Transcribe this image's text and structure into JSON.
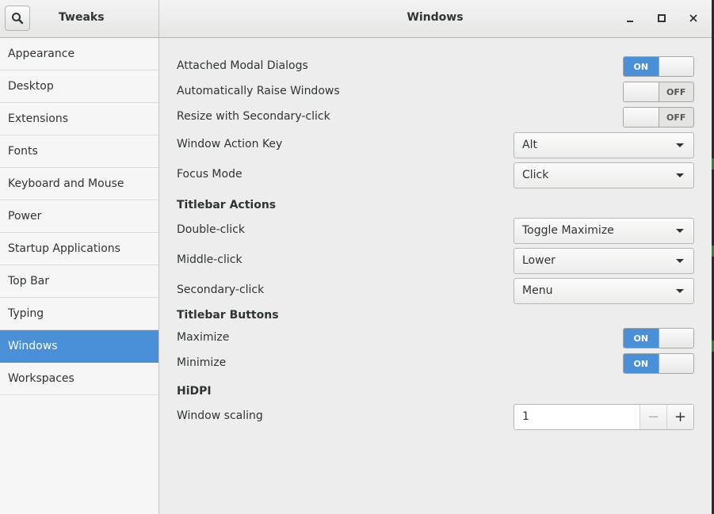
{
  "header": {
    "app_title": "Tweaks",
    "window_title": "Windows",
    "search_icon": "search-icon",
    "controls": [
      "minimize-icon",
      "maximize-icon",
      "close-icon"
    ]
  },
  "sidebar": {
    "items": [
      {
        "label": "Appearance"
      },
      {
        "label": "Desktop"
      },
      {
        "label": "Extensions"
      },
      {
        "label": "Fonts"
      },
      {
        "label": "Keyboard and Mouse"
      },
      {
        "label": "Power"
      },
      {
        "label": "Startup Applications"
      },
      {
        "label": "Top Bar"
      },
      {
        "label": "Typing"
      },
      {
        "label": "Windows",
        "selected": true
      },
      {
        "label": "Workspaces"
      }
    ]
  },
  "settings": {
    "attached_modal": {
      "label": "Attached Modal Dialogs",
      "state": "ON"
    },
    "auto_raise": {
      "label": "Automatically Raise Windows",
      "state": "OFF"
    },
    "resize_secondary": {
      "label": "Resize with Secondary-click",
      "state": "OFF"
    },
    "action_key": {
      "label": "Window Action Key",
      "value": "Alt"
    },
    "focus_mode": {
      "label": "Focus Mode",
      "value": "Click"
    }
  },
  "titlebar_actions": {
    "heading": "Titlebar Actions",
    "double_click": {
      "label": "Double-click",
      "value": "Toggle Maximize"
    },
    "middle_click": {
      "label": "Middle-click",
      "value": "Lower"
    },
    "secondary_click": {
      "label": "Secondary-click",
      "value": "Menu"
    }
  },
  "titlebar_buttons": {
    "heading": "Titlebar Buttons",
    "maximize": {
      "label": "Maximize",
      "state": "ON"
    },
    "minimize": {
      "label": "Minimize",
      "state": "ON"
    }
  },
  "hidpi": {
    "heading": "HiDPI",
    "scaling": {
      "label": "Window scaling",
      "value": "1",
      "minus": "−",
      "plus": "+"
    }
  },
  "colors": {
    "accent": "#4a90d9",
    "background": "#ededed",
    "sidebar": "#f6f6f6"
  }
}
